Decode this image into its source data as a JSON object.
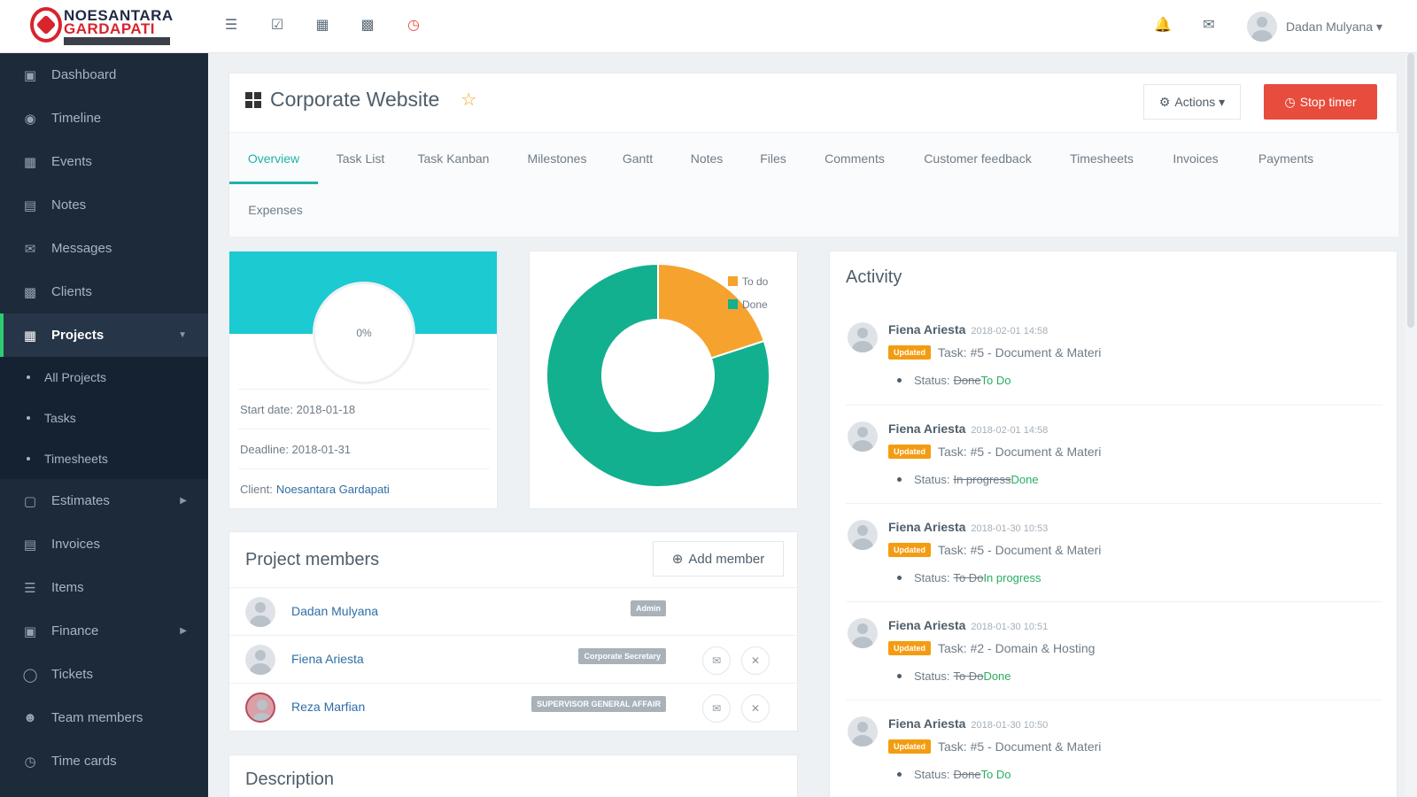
{
  "brand": {
    "line1": "NOESANTARA",
    "line2": "GARDAPATI"
  },
  "topbar": {
    "user_name": "Dadan Mulyana ▾"
  },
  "sidebar": {
    "items": [
      {
        "label": "Dashboard",
        "icon": "monitor-icon"
      },
      {
        "label": "Timeline",
        "icon": "comments-icon"
      },
      {
        "label": "Events",
        "icon": "calendar-icon"
      },
      {
        "label": "Notes",
        "icon": "book-icon"
      },
      {
        "label": "Messages",
        "icon": "envelope-icon"
      },
      {
        "label": "Clients",
        "icon": "briefcase-icon"
      },
      {
        "label": "Projects",
        "icon": "th-large-icon"
      },
      {
        "label": "Estimates",
        "icon": "file-icon"
      },
      {
        "label": "Invoices",
        "icon": "file-text-icon"
      },
      {
        "label": "Items",
        "icon": "list-icon"
      },
      {
        "label": "Finance",
        "icon": "money-icon"
      },
      {
        "label": "Tickets",
        "icon": "life-ring-icon"
      },
      {
        "label": "Team members",
        "icon": "user-icon"
      },
      {
        "label": "Time cards",
        "icon": "clock-icon"
      }
    ],
    "projects_sub": [
      "All Projects",
      "Tasks",
      "Timesheets"
    ]
  },
  "project": {
    "title": "Corporate Website",
    "actions_label": "Actions ▾",
    "stop_timer_label": "Stop timer",
    "tabs": [
      "Overview",
      "Task List",
      "Task Kanban",
      "Milestones",
      "Gantt",
      "Notes",
      "Files",
      "Comments",
      "Customer feedback",
      "Timesheets",
      "Invoices",
      "Payments",
      "Expenses"
    ],
    "progress_text": "0%",
    "progress_percent": 0,
    "start_date": "Start date: 2018-01-18",
    "deadline": "Deadline: 2018-01-31",
    "client_label": "Client:",
    "client_name": "Noesantara Gardapati"
  },
  "chart_data": {
    "type": "pie",
    "categories": [
      "To do",
      "Done"
    ],
    "values": [
      20,
      80
    ],
    "colors": [
      "#f5a22e",
      "#12b08e"
    ],
    "legend": "top-right"
  },
  "members": {
    "title": "Project members",
    "add_label": "Add member",
    "rows": [
      {
        "name": "Dadan Mulyana",
        "role": "Admin"
      },
      {
        "name": "Fiena Ariesta",
        "role": "Corporate Secretary"
      },
      {
        "name": "Reza Marfian",
        "role": "SUPERVISOR GENERAL AFFAIR"
      }
    ]
  },
  "description": {
    "title": "Description"
  },
  "activity": {
    "title": "Activity",
    "items": [
      {
        "user": "Fiena Ariesta",
        "time": "2018-02-01 14:58",
        "badge": "Updated",
        "task": "Task: #5 - Document & Materi",
        "status_label": "Status:",
        "old": "Done",
        "new": "To Do"
      },
      {
        "user": "Fiena Ariesta",
        "time": "2018-02-01 14:58",
        "badge": "Updated",
        "task": "Task: #5 - Document & Materi",
        "status_label": "Status:",
        "old": "In progress",
        "new": "Done"
      },
      {
        "user": "Fiena Ariesta",
        "time": "2018-01-30 10:53",
        "badge": "Updated",
        "task": "Task: #5 - Document & Materi",
        "status_label": "Status:",
        "old": "To Do",
        "new": "In progress"
      },
      {
        "user": "Fiena Ariesta",
        "time": "2018-01-30 10:51",
        "badge": "Updated",
        "task": "Task: #2 - Domain & Hosting",
        "status_label": "Status:",
        "old": "To Do",
        "new": "Done"
      },
      {
        "user": "Fiena Ariesta",
        "time": "2018-01-30 10:50",
        "badge": "Updated",
        "task": "Task: #5 - Document & Materi",
        "status_label": "Status:",
        "old": "Done",
        "new": "To Do"
      }
    ]
  }
}
